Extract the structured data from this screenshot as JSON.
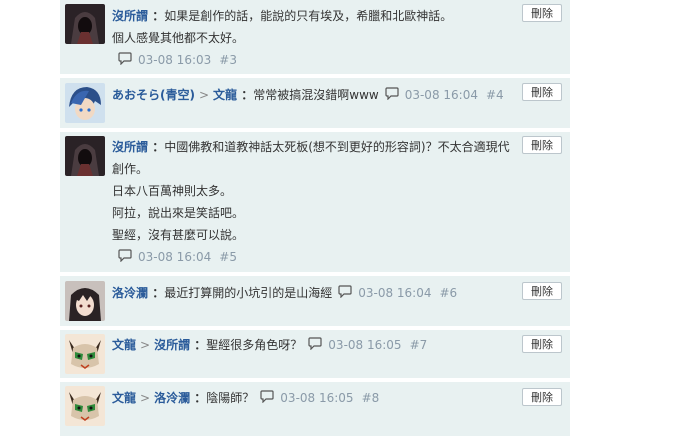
{
  "delete_label": "刪除",
  "comments": [
    {
      "author": "沒所謂",
      "reply_to": "",
      "lines": [
        "如果是創作的話，能說的只有埃及，希臘和北歐神話。",
        "個人感覺其他都不太好。"
      ],
      "time": "03-08 16:03",
      "floor": "#3",
      "avatar": "dark-hooded-avatar"
    },
    {
      "author": "あおそら(青空)",
      "reply_to": "文龍",
      "lines": [
        "常常被搞混沒錯啊www"
      ],
      "time": "03-08 16:04",
      "floor": "#4",
      "avatar": "blue-hair-avatar"
    },
    {
      "author": "沒所謂",
      "reply_to": "",
      "lines": [
        "中國佛教和道教神話太死板(想不到更好的形容詞)？不太合適現代",
        "創作。",
        "日本八百萬神則太多。",
        "阿拉，說出來是笑話吧。",
        "聖經，沒有甚麼可以說。"
      ],
      "time": "03-08 16:04",
      "floor": "#5",
      "avatar": "dark-hooded-avatar"
    },
    {
      "author": "洛泠瀾",
      "reply_to": "",
      "lines": [
        "最近打算開的小坑引的是山海經"
      ],
      "time": "03-08 16:04",
      "floor": "#6",
      "avatar": "dark-hair-girl-avatar"
    },
    {
      "author": "文龍",
      "reply_to": "沒所謂",
      "lines": [
        "聖經很多角色呀？"
      ],
      "time": "03-08 16:05",
      "floor": "#7",
      "avatar": "cat-mask-avatar"
    },
    {
      "author": "文龍",
      "reply_to": "洛泠瀾",
      "lines": [
        "陰陽師？"
      ],
      "time": "03-08 16:05",
      "floor": "#8",
      "avatar": "cat-mask-avatar"
    }
  ]
}
